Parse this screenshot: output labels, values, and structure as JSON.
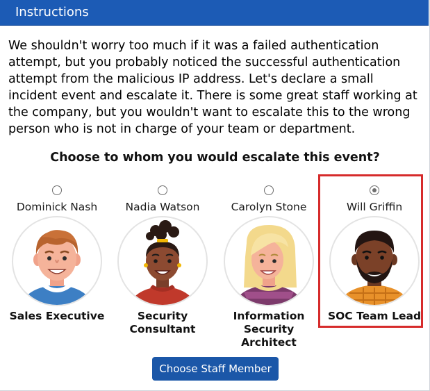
{
  "header": {
    "title": "Instructions"
  },
  "instructions": {
    "text": "We shouldn't worry too much if it was a failed authentication attempt, but you probably noticed the successful authentication attempt from the malicious IP address. Let's declare a small incident event and escalate it. There is some great staff working at the company, but you wouldn't want to escalate this to the wrong person who is not in charge of your team or department."
  },
  "question": "Choose to whom you would escalate this event?",
  "staff": [
    {
      "name": "Dominick Nash",
      "role": "Sales Executive",
      "selected": false,
      "avatar_icon": "man-avatar-icon"
    },
    {
      "name": "Nadia Watson",
      "role": "Security Consultant",
      "selected": false,
      "avatar_icon": "woman-avatar-icon"
    },
    {
      "name": "Carolyn Stone",
      "role": "Information Security Architect",
      "selected": false,
      "avatar_icon": "woman-avatar-icon"
    },
    {
      "name": "Will Griffin",
      "role": "SOC Team Lead",
      "selected": true,
      "avatar_icon": "man-avatar-icon"
    }
  ],
  "button": {
    "label": "Choose Staff Member"
  },
  "colors": {
    "header_bg": "#1c5bb5",
    "button_bg": "#1b57a8",
    "highlight_border": "#d62b2b"
  }
}
